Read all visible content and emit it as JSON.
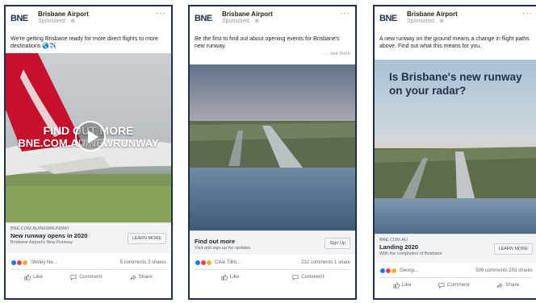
{
  "cards": [
    {
      "logo": "BNE",
      "page_name": "Brisbane Airport",
      "sponsored": "Sponsored · ⊕",
      "more": "···",
      "caption": "We're getting Brisbane ready for more direct flights to more destinations 🌏✈️",
      "overlay_line1": "FIND OUT MORE",
      "overlay_line2": "BNE.COM.AU/NEWRUNWAY",
      "domain": "BNE.COM.AU/NEWRUNWAY",
      "headline": "New runway opens in 2020",
      "description": "Brisbane Airport's New Runway",
      "cta": "LEARN MORE",
      "reaction_names": "Shirley Ne...",
      "reaction_stats": "5 comments  3 shares",
      "actions": [
        "Like",
        "Comment",
        "Share"
      ]
    },
    {
      "logo": "BNE",
      "page_name": "Brisbane Airport",
      "sponsored": "Sponsored · ⊕",
      "more": "···",
      "caption": "Be the first to find out about opening events for Brisbane's new runway.",
      "see_more": "... see more",
      "domain": "",
      "headline": "Find out more",
      "description": "Visit and sign up for updates",
      "cta": "Sign Up",
      "reaction_names": "Clive Tillm...",
      "reaction_stats": "232 comments  1 share",
      "actions": [
        "Like",
        "Comment"
      ]
    },
    {
      "logo": "BNE",
      "page_name": "Brisbane Airport",
      "sponsored": "Sponsored · ⊕",
      "more": "···",
      "caption": "A new runway on the ground means a change in flight paths above. Find out what this means for you.",
      "overlay_title": "Is Brisbane's new runway on your radar?",
      "domain": "BNE.COM.AU",
      "headline": "Landing 2020",
      "description": "With the completion of Brisbane",
      "cta": "LEARN MORE",
      "reaction_names": "Georgi...",
      "reaction_stats": "506 comments  203 shares",
      "actions": [
        "Like",
        "Comment",
        "Share"
      ]
    }
  ]
}
